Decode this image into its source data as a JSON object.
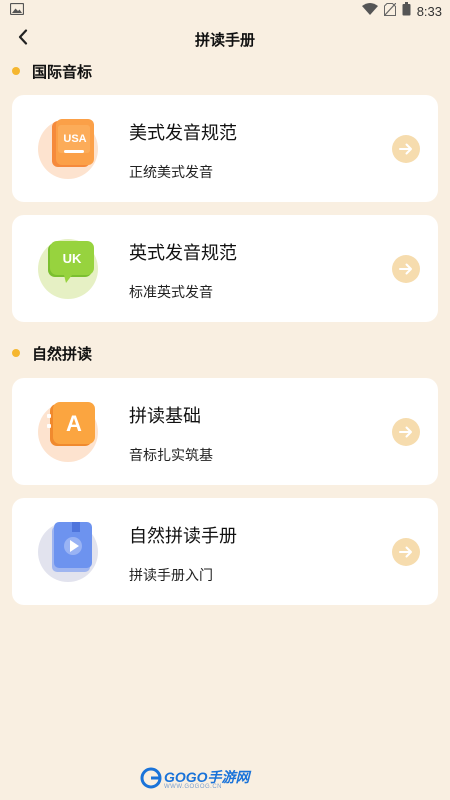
{
  "status_bar": {
    "time": "8:33"
  },
  "nav": {
    "title": "拼读手册"
  },
  "sections": [
    {
      "title": "国际音标",
      "cards": [
        {
          "title": "美式发音规范",
          "subtitle": "正统美式发音",
          "icon": "usa-book-icon",
          "icon_text": "USA"
        },
        {
          "title": "英式发音规范",
          "subtitle": "标准英式发音",
          "icon": "uk-chat-icon",
          "icon_text": "UK"
        }
      ]
    },
    {
      "title": "自然拼读",
      "cards": [
        {
          "title": "拼读基础",
          "subtitle": "音标扎实筑基",
          "icon": "letter-a-icon",
          "icon_text": "A"
        },
        {
          "title": "自然拼读手册",
          "subtitle": "拼读手册入门",
          "icon": "video-book-icon",
          "icon_text": ""
        }
      ]
    }
  ],
  "watermark": {
    "brand": "GOGO手游网",
    "url": "WWW.GOGOG.CN"
  },
  "colors": {
    "background": "#f9efe1",
    "accent_dot": "#f5b62f",
    "arrow_bg": "#f6dcae",
    "card_bg": "#ffffff"
  }
}
